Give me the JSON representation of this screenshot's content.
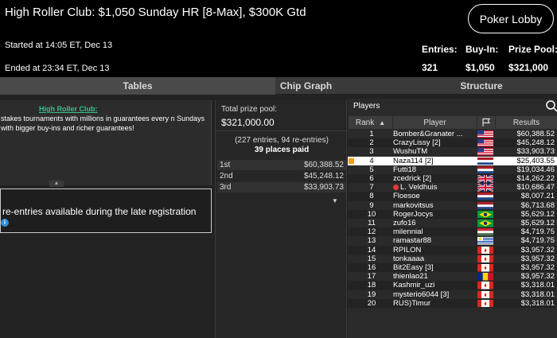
{
  "header": {
    "title": "High Roller Club: $1,050 Sunday HR [8-Max], $300K Gtd",
    "lobby_button": "Poker Lobby",
    "started": "Started at 14:05 ET, Dec 13",
    "ended": "Ended at 23:34 ET, Dec 13",
    "entries_label": "Entries:",
    "entries_value": "321",
    "buyin_label": "Buy-In:",
    "buyin_value": "$1,050",
    "prizepool_label": "Prize Pool:",
    "prizepool_value": "$321,000"
  },
  "tabs": [
    "Tables",
    "Chip Graph",
    "Structure"
  ],
  "promo": {
    "title": "High Roller Club:",
    "text": "stakes tournaments with millions in guarantees every n Sundays with bigger buy-ins and richer guarantees!"
  },
  "reentry": {
    "text": "re-entries available during the late registration",
    "icon": "i"
  },
  "prize": {
    "label": "Total prize pool:",
    "value": "$321,000.00",
    "entries_info": "(227 entries, 94 re-entries)",
    "places_paid": "39 places paid",
    "payouts": [
      {
        "place": "1st",
        "amount": "$60,388.52"
      },
      {
        "place": "2nd",
        "amount": "$45,248.12"
      },
      {
        "place": "3rd",
        "amount": "$33,903.73"
      }
    ]
  },
  "players": {
    "title": "Players",
    "col_rank": "Rank",
    "col_player": "Player",
    "col_results": "Results",
    "rows": [
      {
        "rank": "1",
        "name": "Bomber&Granater ...",
        "flag": "us",
        "result": "$60,388.52"
      },
      {
        "rank": "2",
        "name": "CrazyLissy [2]",
        "flag": "us",
        "result": "$45,248.12"
      },
      {
        "rank": "3",
        "name": "WushuTM",
        "flag": "us",
        "result": "$33,903.73"
      },
      {
        "rank": "4",
        "name": "Naza114 [2]",
        "flag": "nl",
        "result": "$25,403.55"
      },
      {
        "rank": "5",
        "name": "Futti18",
        "flag": "nl",
        "result": "$19,034.46"
      },
      {
        "rank": "6",
        "name": "zcedrick [2]",
        "flag": "gb",
        "result": "$14,262.22"
      },
      {
        "rank": "7",
        "name": "L. Veldhuis",
        "flag": "gb",
        "result": "$10,686.47"
      },
      {
        "rank": "8",
        "name": "Floesoe",
        "flag": "nl",
        "result": "$8,007.21"
      },
      {
        "rank": "9",
        "name": "markovitsus",
        "flag": "nl",
        "result": "$6,713.68"
      },
      {
        "rank": "10",
        "name": "RogerJocys",
        "flag": "br",
        "result": "$5,629.12"
      },
      {
        "rank": "11",
        "name": "zufo16",
        "flag": "br",
        "result": "$5,629.12"
      },
      {
        "rank": "12",
        "name": "milennial",
        "flag": "hu",
        "result": "$4,719.75"
      },
      {
        "rank": "13",
        "name": "ramastar88",
        "flag": "uy",
        "result": "$4,719.75"
      },
      {
        "rank": "14",
        "name": "RPILON",
        "flag": "ca",
        "result": "$3,957.32"
      },
      {
        "rank": "15",
        "name": "tonkaaaa",
        "flag": "ca",
        "result": "$3,957.32"
      },
      {
        "rank": "16",
        "name": "Bit2Easy [3]",
        "flag": "ca",
        "result": "$3,957.32"
      },
      {
        "rank": "17",
        "name": "thienlao21",
        "flag": "ro",
        "result": "$3,957.32"
      },
      {
        "rank": "18",
        "name": "Kashmir_uzi",
        "flag": "ca",
        "result": "$3,318.01"
      },
      {
        "rank": "19",
        "name": "mysterio6044 [3]",
        "flag": "ca",
        "result": "$3,318.01"
      },
      {
        "rank": "20",
        "name": "RUS)Timur",
        "flag": "ca",
        "result": "$3,318.01"
      }
    ]
  },
  "colors": {
    "accent_green": "#3fbf8a",
    "highlight_orange": "#f39c1e",
    "info_blue": "#2d8fd8"
  }
}
